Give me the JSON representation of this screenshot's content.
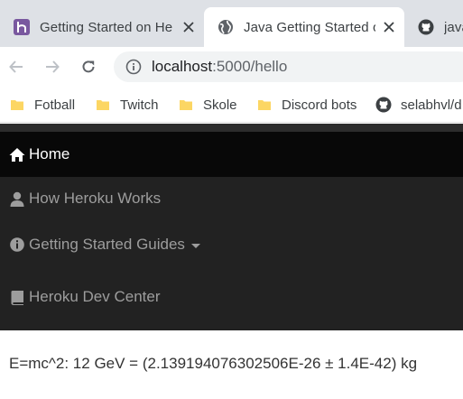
{
  "browser": {
    "tabs": [
      {
        "title": "Getting Started on He",
        "icon": "heroku-logo-icon",
        "active": false
      },
      {
        "title": "Java Getting Started o",
        "icon": "globe-icon",
        "active": true
      },
      {
        "title": "java",
        "icon": "github-icon",
        "active": false
      }
    ],
    "address": {
      "host": "localhost",
      "rest": ":5000/hello"
    },
    "bookmarks": [
      {
        "label": "Fotball",
        "icon": "folder-icon"
      },
      {
        "label": "Twitch",
        "icon": "folder-icon"
      },
      {
        "label": "Skole",
        "icon": "folder-icon"
      },
      {
        "label": "Discord bots",
        "icon": "folder-icon"
      },
      {
        "label": "selabhvl/d",
        "icon": "github-icon"
      }
    ],
    "colors": {
      "tabstrip": "#dee1e6",
      "omnibox": "#f1f3f4",
      "folder": "#fcd663"
    }
  },
  "nav": {
    "home": {
      "label": "Home",
      "icon": "home-icon"
    },
    "items": [
      {
        "label": "How Heroku Works",
        "icon": "user-icon"
      },
      {
        "label": "Getting Started Guides",
        "icon": "info-sign-icon",
        "dropdown": true
      },
      {
        "label": "Heroku Dev Center",
        "icon": "book-icon"
      }
    ],
    "colors": {
      "bg": "#222222",
      "home_bg": "#080808",
      "text": "#9d9d9d",
      "active_text": "#ffffff"
    }
  },
  "content": {
    "result": "E=mc^2: 12 GeV = (2.139194076302506E-26 ± 1.4E-42) kg"
  }
}
